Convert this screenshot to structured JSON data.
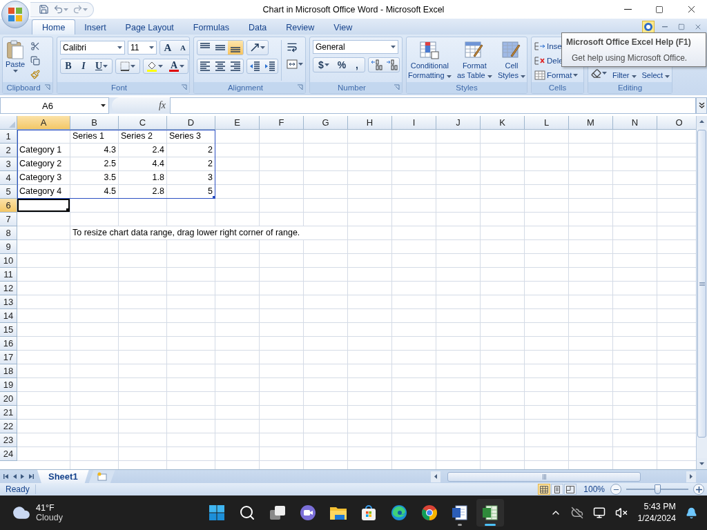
{
  "window": {
    "title": "Chart in Microsoft Office Word - Microsoft Excel"
  },
  "tabs": [
    {
      "label": "Home",
      "selected": true
    },
    {
      "label": "Insert",
      "selected": false
    },
    {
      "label": "Page Layout",
      "selected": false
    },
    {
      "label": "Formulas",
      "selected": false
    },
    {
      "label": "Data",
      "selected": false
    },
    {
      "label": "Review",
      "selected": false
    },
    {
      "label": "View",
      "selected": false
    }
  ],
  "tooltip": {
    "title": "Microsoft Office Excel Help (F1)",
    "text": "Get help using Microsoft Office."
  },
  "ribbon": [
    {
      "kind": "clipboard",
      "label": "Clipboard",
      "paste": "Paste"
    },
    {
      "kind": "font",
      "label": "Font",
      "font_name": "Calibri",
      "font_size": "11",
      "grow": "A",
      "shrink": "A",
      "bold": "B",
      "italic": "I",
      "underline": "U",
      "font_color": "A"
    },
    {
      "kind": "alignment",
      "label": "Alignment",
      "vertical": [
        {
          "selected": false
        },
        {
          "selected": false
        },
        {
          "selected": true
        }
      ]
    },
    {
      "kind": "number",
      "label": "Number",
      "format": "General",
      "currency": "$",
      "percent": "%",
      "comma": ","
    },
    {
      "kind": "styles",
      "label": "Styles",
      "buttons": [
        {
          "lines": [
            "Conditional",
            "Formatting"
          ]
        },
        {
          "lines": [
            "Format",
            "as Table"
          ]
        },
        {
          "lines": [
            "Cell",
            "Styles"
          ]
        }
      ]
    },
    {
      "kind": "cells",
      "label": "Cells",
      "buttons": [
        "Inse",
        "Dele",
        "Format"
      ]
    },
    {
      "kind": "editing",
      "label": "Editing",
      "buttons": [
        {
          "lines": [
            "Filter"
          ]
        },
        {
          "lines": [
            "Select"
          ]
        }
      ]
    }
  ],
  "formula_bar": {
    "name_box": "A6",
    "function_label": "fx"
  },
  "sheet": {
    "columns": [
      "A",
      "B",
      "C",
      "D",
      "E",
      "F",
      "G",
      "H",
      "I",
      "J",
      "K",
      "L",
      "M",
      "N",
      "O"
    ],
    "rows": [
      {
        "number": "1",
        "cells": [
          {
            "selected": false
          },
          {
            "text": "Series 1",
            "kind": "text",
            "selected": false
          },
          {
            "text": "Series 2",
            "kind": "text",
            "selected": false
          },
          {
            "text": "Series 3",
            "kind": "text",
            "selected": false
          }
        ]
      },
      {
        "number": "2",
        "cells": [
          {
            "text": "Category 1",
            "kind": "text",
            "selected": false
          },
          {
            "text": "4.3",
            "kind": "number",
            "selected": false
          },
          {
            "text": "2.4",
            "kind": "number",
            "selected": false
          },
          {
            "text": "2",
            "kind": "number",
            "selected": false
          }
        ]
      },
      {
        "number": "3",
        "cells": [
          {
            "text": "Category 2",
            "kind": "text",
            "selected": false
          },
          {
            "text": "2.5",
            "kind": "number",
            "selected": false
          },
          {
            "text": "4.4",
            "kind": "number",
            "selected": false
          },
          {
            "text": "2",
            "kind": "number",
            "selected": false
          }
        ]
      },
      {
        "number": "4",
        "cells": [
          {
            "text": "Category 3",
            "kind": "text",
            "selected": false
          },
          {
            "text": "3.5",
            "kind": "number",
            "selected": false
          },
          {
            "text": "1.8",
            "kind": "number",
            "selected": false
          },
          {
            "text": "3",
            "kind": "number",
            "selected": false
          }
        ]
      },
      {
        "number": "5",
        "cells": [
          {
            "text": "Category 4",
            "kind": "text",
            "selected": false
          },
          {
            "text": "4.5",
            "kind": "number",
            "selected": false
          },
          {
            "text": "2.8",
            "kind": "number",
            "selected": false
          },
          {
            "text": "5",
            "kind": "number",
            "selected": false
          }
        ]
      },
      {
        "number": "6",
        "cells": [
          {
            "selected": true
          }
        ]
      },
      {
        "number": "7"
      },
      {
        "number": "8",
        "cells": [
          {
            "selected": false
          },
          {
            "text": "To resize chart data range, drag lower right corner of range.",
            "kind": "text",
            "selected": false
          }
        ]
      },
      {
        "number": "9"
      },
      {
        "number": "10"
      },
      {
        "number": "11"
      },
      {
        "number": "12"
      },
      {
        "number": "13"
      },
      {
        "number": "14"
      },
      {
        "number": "15"
      },
      {
        "number": "16"
      },
      {
        "number": "17"
      },
      {
        "number": "18"
      },
      {
        "number": "19"
      },
      {
        "number": "20"
      },
      {
        "number": "21"
      },
      {
        "number": "22"
      },
      {
        "number": "23"
      },
      {
        "number": "24"
      }
    ]
  },
  "sheet_tabs": [
    {
      "label": "Sheet1",
      "selected": true
    }
  ],
  "status_bar": {
    "status": "Ready",
    "views": [
      {
        "kind": "normal",
        "selected": true
      },
      {
        "kind": "page-layout",
        "selected": false
      },
      {
        "kind": "page-break",
        "selected": false
      }
    ],
    "zoom": "100%",
    "zoom_slider": {
      "level": 0.5
    }
  },
  "taskbar": {
    "weather": {
      "temperature": "41°F",
      "condition": "Cloudy"
    },
    "apps": [
      {
        "kind": "start",
        "selected": false,
        "running": false
      },
      {
        "kind": "search",
        "selected": false,
        "running": false
      },
      {
        "kind": "task-view",
        "selected": false,
        "running": false
      },
      {
        "kind": "chat",
        "selected": false,
        "running": false
      },
      {
        "kind": "folder",
        "selected": false,
        "running": false
      },
      {
        "kind": "store",
        "selected": false,
        "running": false
      },
      {
        "kind": "edge",
        "selected": false,
        "running": false
      },
      {
        "kind": "chrome",
        "selected": false,
        "running": false
      },
      {
        "kind": "word",
        "selected": false,
        "running": true
      },
      {
        "kind": "excel",
        "selected": true,
        "running": true
      }
    ],
    "time": "5:43 PM",
    "date": "1/24/2024"
  }
}
